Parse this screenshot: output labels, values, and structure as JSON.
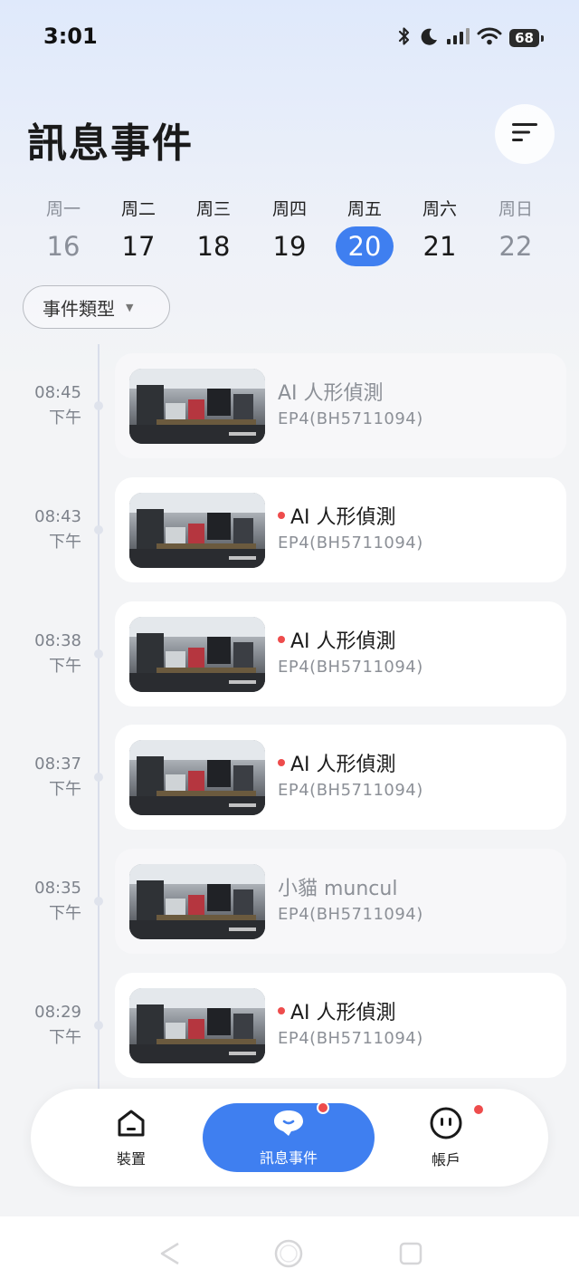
{
  "status": {
    "time": "3:01",
    "battery": "68"
  },
  "header": {
    "title": "訊息事件"
  },
  "week": [
    {
      "label": "周一",
      "day": "16",
      "state": "dim"
    },
    {
      "label": "周二",
      "day": "17",
      "state": "normal"
    },
    {
      "label": "周三",
      "day": "18",
      "state": "normal"
    },
    {
      "label": "周四",
      "day": "19",
      "state": "normal"
    },
    {
      "label": "周五",
      "day": "20",
      "state": "selected"
    },
    {
      "label": "周六",
      "day": "21",
      "state": "normal"
    },
    {
      "label": "周日",
      "day": "22",
      "state": "dim"
    }
  ],
  "filter": {
    "event_type_label": "事件類型"
  },
  "events": [
    {
      "time": "08:45",
      "period": "下午",
      "title": "AI 人形偵測",
      "device": "EP4(BH5711094)",
      "unread": false
    },
    {
      "time": "08:43",
      "period": "下午",
      "title": "AI 人形偵測",
      "device": "EP4(BH5711094)",
      "unread": true
    },
    {
      "time": "08:38",
      "period": "下午",
      "title": "AI 人形偵測",
      "device": "EP4(BH5711094)",
      "unread": true
    },
    {
      "time": "08:37",
      "period": "下午",
      "title": "AI 人形偵測",
      "device": "EP4(BH5711094)",
      "unread": true
    },
    {
      "time": "08:35",
      "period": "下午",
      "title": "小貓 muncul",
      "device": "EP4(BH5711094)",
      "unread": false
    },
    {
      "time": "08:29",
      "period": "下午",
      "title": "AI 人形偵測",
      "device": "EP4(BH5711094)",
      "unread": true
    }
  ],
  "nav": {
    "devices": "裝置",
    "events": "訊息事件",
    "account": "帳戶"
  },
  "colors": {
    "accent": "#3f7ff0",
    "badge": "#ee4c4c"
  },
  "icons": {
    "status": [
      "bluetooth-icon",
      "moon-icon",
      "signal-icon",
      "wifi-icon",
      "battery-icon"
    ],
    "header": "sort-icon",
    "nav": [
      "home-icon",
      "chat-bubble-icon",
      "face-icon"
    ],
    "system": [
      "back-icon",
      "home-circle-icon",
      "recents-icon"
    ]
  }
}
